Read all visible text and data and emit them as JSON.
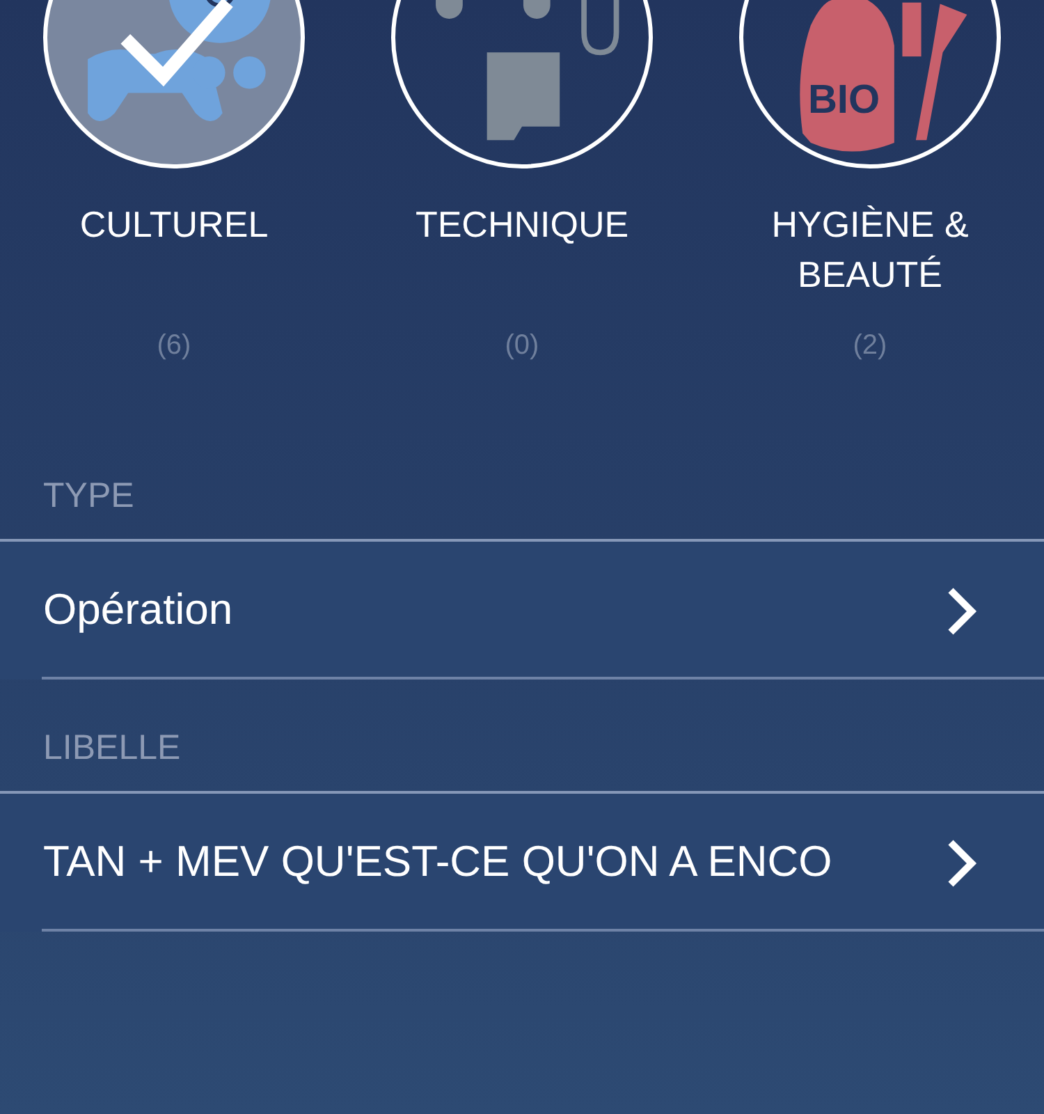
{
  "categories": [
    {
      "kind": "media",
      "label": "CULTUREL",
      "count": "(6)",
      "selected": true,
      "color": "#6fa3dc"
    },
    {
      "kind": "tech",
      "label": "TECHNIQUE",
      "count": "(0)",
      "selected": false,
      "color": "#7f8a96"
    },
    {
      "kind": "beauty",
      "label": "HYGIÈNE & BEAUTÉ",
      "count": "(2)",
      "selected": false,
      "color": "#c8606c",
      "badge": "BIO"
    }
  ],
  "sections": [
    {
      "header": "TYPE",
      "value": "Opération"
    },
    {
      "header": "LIBELLE",
      "value": "TAN + MEV QU'EST-CE QU'ON A ENCO"
    }
  ]
}
